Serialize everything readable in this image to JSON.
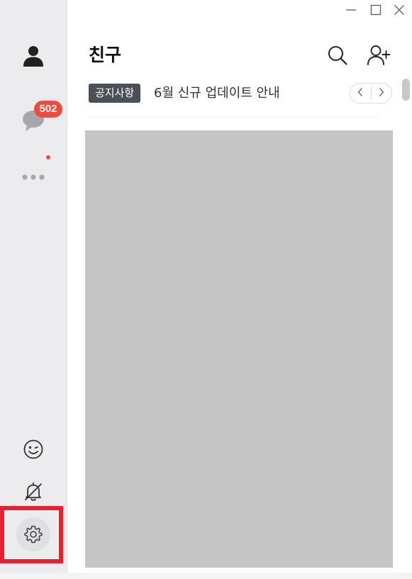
{
  "window": {
    "controls": [
      "minimize-icon",
      "maximize-icon",
      "close-icon"
    ]
  },
  "sidebar": {
    "items": [
      {
        "name": "friends",
        "icon": "person-icon"
      },
      {
        "name": "chats",
        "icon": "chat-bubble-icon",
        "badge": "502"
      },
      {
        "name": "more",
        "icon": "more-dots-icon",
        "has_new_dot": true
      },
      {
        "name": "emoticon",
        "icon": "emoticon-icon"
      },
      {
        "name": "notifications",
        "icon": "bell-muted-icon"
      },
      {
        "name": "settings",
        "icon": "gear-icon",
        "highlighted": true
      }
    ]
  },
  "header": {
    "title": "친구",
    "actions": [
      "search-icon",
      "add-friend-icon"
    ]
  },
  "notice": {
    "tag": "공지사항",
    "text": "6월 신규 업데이트 안내",
    "prev_icon": "chevron-left-icon",
    "next_icon": "chevron-right-icon"
  },
  "colors": {
    "sidebar_bg": "#ececee",
    "badge": "#f14a3e",
    "notice_tag_bg": "#495057",
    "highlight": "#e8212e",
    "content_placeholder": "#c5c5c5"
  }
}
